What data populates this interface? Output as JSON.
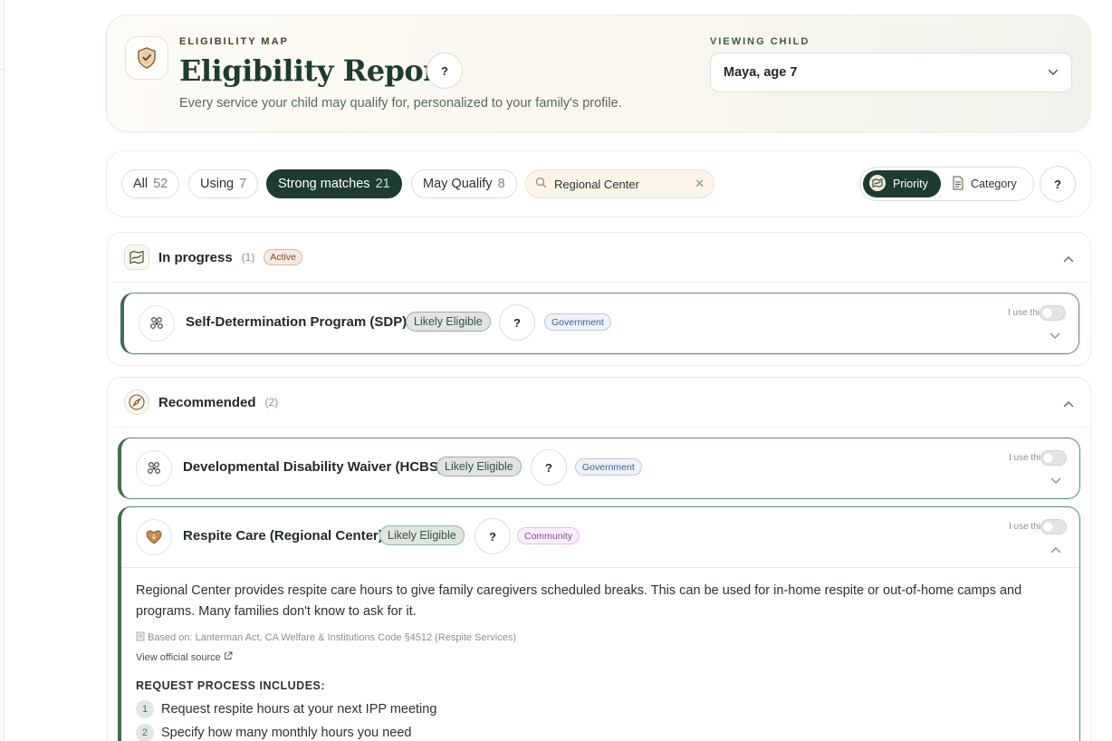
{
  "header": {
    "eyebrow": "ELIGIBILITY MAP",
    "title": "Eligibility Report",
    "help": "?",
    "subtitle": "Every service your child may qualify for, personalized to your family's profile.",
    "viewing_label": "VIEWING CHILD",
    "child_selected": "Maya, age 7"
  },
  "filters": {
    "chips": [
      {
        "label": "All",
        "count": "52"
      },
      {
        "label": "Using",
        "count": "7"
      },
      {
        "label": "Strong matches",
        "count": "21"
      },
      {
        "label": "May Qualify",
        "count": "8"
      }
    ],
    "active_chip": "Strong matches",
    "search_value": "Regional Center",
    "sort_options": [
      "Priority",
      "Category"
    ],
    "sort_selected": "Priority",
    "help": "?"
  },
  "sections": [
    {
      "title": "In progress",
      "count": "(1)",
      "badge": "Active",
      "services": [
        {
          "name": "Self-Determination Program (SDP)",
          "eligibility": "Likely Eligible",
          "help": "?",
          "tag": "Government",
          "use_label": "I use this"
        }
      ]
    },
    {
      "title": "Recommended",
      "count": "(2)",
      "services": [
        {
          "name": "Developmental Disability Waiver (HCBS)",
          "eligibility": "Likely Eligible",
          "help": "?",
          "tag": "Government",
          "use_label": "I use this"
        },
        {
          "name": "Respite Care (Regional Center)",
          "eligibility": "Likely Eligible",
          "help": "?",
          "tag": "Community",
          "use_label": "I use this",
          "description": "Regional Center provides respite care hours to give family caregivers scheduled breaks. This can be used for in-home respite or out-of-home camps and programs. Many families don't know to ask for it.",
          "based_on": "Based on: Lanterman Act, CA Welfare & Institutions Code §4512 (Respite Services)",
          "source_link": "View official source",
          "process_heading": "REQUEST PROCESS INCLUDES:",
          "steps": [
            {
              "num": "1",
              "text": "Request respite hours at your next IPP meeting"
            },
            {
              "num": "2",
              "text": "Specify how many monthly hours you need"
            }
          ]
        }
      ]
    }
  ],
  "colors": {
    "brand_dark_green": "#1d3b2f",
    "accent_green": "#3f6d4f",
    "active_badge": "#7a4d33",
    "government_tag": "#3f5f8f",
    "community_tag": "#8a4a9e"
  }
}
